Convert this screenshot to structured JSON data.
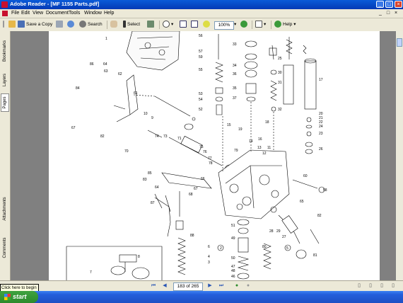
{
  "window": {
    "title": "Adobe Reader - [MF 1155 Parts.pdf]",
    "minimize_glyph": "_",
    "maximize_glyph": "□",
    "close_glyph": "×"
  },
  "menu": {
    "items": [
      "File",
      "Edit",
      "View",
      "Document",
      "Tools",
      "Window",
      "Help"
    ],
    "doc_controls": [
      "_",
      "□",
      "×"
    ]
  },
  "toolbar": {
    "save_copy": "Save a Copy",
    "search": "Search",
    "select": "Select",
    "zoom": "100%",
    "help": "Help"
  },
  "nav_tabs": {
    "bookmarks": "Bookmarks",
    "layers": "Layers",
    "pages": "Pages",
    "attachments": "Attachments",
    "comments": "Comments"
  },
  "status": {
    "page_indicator": "183 of 265",
    "tooltip": "Click here to begin"
  },
  "taskbar": {
    "start": "start"
  },
  "diagram_labels": [
    "1",
    "86",
    "64",
    "62",
    "63",
    "84",
    "67",
    "61",
    "10",
    "9",
    "74",
    "73",
    "71",
    "70",
    "82",
    "83",
    "85",
    "64",
    "87",
    "88",
    "56",
    "57",
    "59",
    "55",
    "53",
    "54",
    "52",
    "33",
    "34",
    "36",
    "35",
    "37",
    "15",
    "19",
    "18",
    "16",
    "14",
    "13",
    "12",
    "11",
    "79",
    "75",
    "76",
    "77",
    "78",
    "66",
    "67",
    "68",
    "2",
    "6",
    "4",
    "3",
    "51",
    "49",
    "50",
    "46",
    "47",
    "48",
    "8",
    "7",
    "30",
    "31",
    "25",
    "28",
    "29",
    "27",
    "32",
    "80",
    "81",
    "5",
    "26",
    "24",
    "23",
    "22",
    "21",
    "20",
    "17",
    "65",
    "60",
    "58",
    "82"
  ],
  "icon_names": [
    "adobe-reader-icon",
    "save-icon",
    "print-icon",
    "email-icon",
    "search-icon",
    "hand-tool-icon",
    "select-tool-icon",
    "snapshot-icon",
    "zoom-icon",
    "fit-page-icon",
    "fit-width-icon",
    "rotate-icon",
    "help-icon",
    "first-page-icon",
    "previous-page-icon",
    "next-page-icon",
    "last-page-icon",
    "back-icon",
    "forward-icon",
    "single-page-icon",
    "continuous-icon",
    "facing-icon",
    "start-flag-icon"
  ]
}
